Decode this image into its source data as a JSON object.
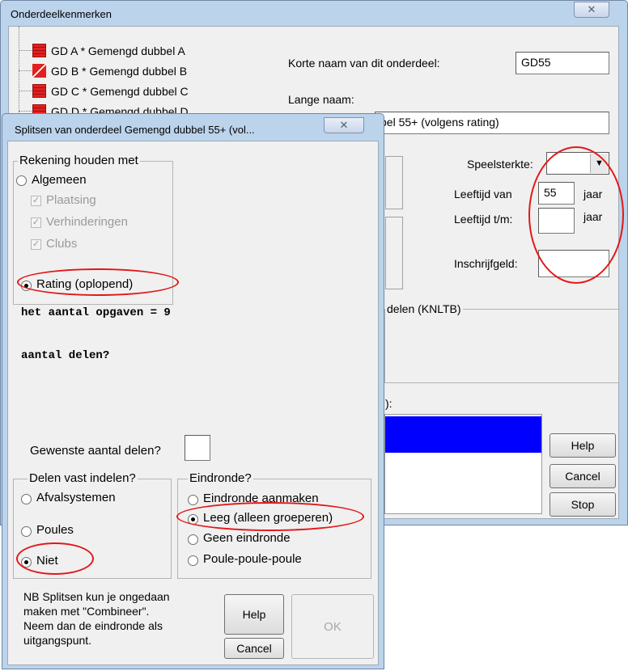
{
  "main_window": {
    "title": "Onderdeelkenmerken",
    "close_glyph": "✕",
    "tree_items": [
      {
        "label": "GD A * Gemengd dubbel A",
        "icon": "grid"
      },
      {
        "label": "GD B * Gemengd dubbel B",
        "icon": "slash"
      },
      {
        "label": "GD C * Gemengd dubbel C",
        "icon": "grid"
      },
      {
        "label": "GD D * Gemengd dubbel D",
        "icon": "grid"
      }
    ],
    "short_name_label": "Korte naam van dit onderdeel:",
    "short_name_value": "GD55",
    "long_name_label": "Lange naam:",
    "long_name_visible_text": "bel 55+ (volgens rating)",
    "speelsterkte_label": "Speelsterkte:",
    "speelsterkte_value": "",
    "leeftijd_van_label": "Leeftijd van",
    "leeftijd_van_value": "55",
    "leeftijd_tm_label": "Leeftijd t/m:",
    "leeftijd_tm_value": "",
    "jaar_label": "jaar",
    "inschrijfgeld_label": "Inschrijfgeld:",
    "inschrijfgeld_value": "",
    "knltb_group_label": "delen (KNLTB)",
    "list_label_fragment": "):",
    "buttons": {
      "help": "Help",
      "cancel": "Cancel",
      "stop": "Stop"
    }
  },
  "split_dialog": {
    "title": "Splitsen van onderdeel Gemengd dubbel 55+ (vol...",
    "close_glyph": "✕",
    "group_rekening": {
      "legend": "Rekening houden met",
      "option_algemeen": "Algemeen",
      "checks": [
        {
          "label": "Plaatsing",
          "checked": true
        },
        {
          "label": "Verhinderingen",
          "checked": true
        },
        {
          "label": "Clubs",
          "checked": true
        }
      ],
      "option_rating": "Rating (oplopend)",
      "selected": "rating"
    },
    "output_line1": "het aantal opgaven = 9",
    "output_line2": "aantal delen?",
    "gewenste_label": "Gewenste aantal delen?",
    "gewenste_value": "",
    "group_delen": {
      "legend": "Delen vast indelen?",
      "options": [
        "Afvalsystemen",
        "Poules",
        "Niet"
      ],
      "selected": "Niet"
    },
    "group_eindronde": {
      "legend": "Eindronde?",
      "options": [
        "Eindronde aanmaken",
        "Leeg (alleen groeperen)",
        "Geen eindronde",
        "Poule-poule-poule"
      ],
      "selected": "Leeg (alleen groeperen)"
    },
    "note_lines": [
      "NB Splitsen kun je ongedaan",
      "maken met \"Combineer\".",
      "Neem dan de eindronde als",
      "uitgangspunt."
    ],
    "buttons": {
      "help": "Help",
      "cancel": "Cancel",
      "ok": "OK"
    }
  },
  "colors": {
    "annotation": "#e21818",
    "selection": "#0000ff",
    "frame": "#bcd3ec"
  }
}
